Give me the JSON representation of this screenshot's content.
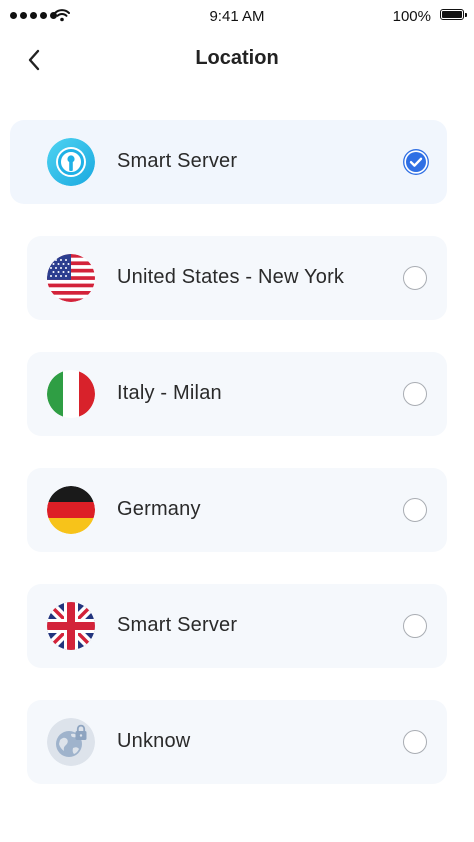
{
  "status_bar": {
    "time": "9:41 AM",
    "battery": "100%"
  },
  "header": {
    "title": "Location"
  },
  "locations": [
    {
      "label": "Smart Server",
      "icon": "smart-server-icon",
      "selected": true
    },
    {
      "label": "United States - New York",
      "icon": "us-flag-icon",
      "selected": false
    },
    {
      "label": "Italy - Milan",
      "icon": "italy-flag-icon",
      "selected": false
    },
    {
      "label": "Germany",
      "icon": "germany-flag-icon",
      "selected": false
    },
    {
      "label": "Smart Server",
      "icon": "uk-flag-icon",
      "selected": false
    },
    {
      "label": "Unknow",
      "icon": "globe-lock-icon",
      "selected": false
    }
  ],
  "colors": {
    "accent": "#2f6fe4",
    "row_background": "#f5f8fc",
    "radio_border": "#a9adb3"
  }
}
